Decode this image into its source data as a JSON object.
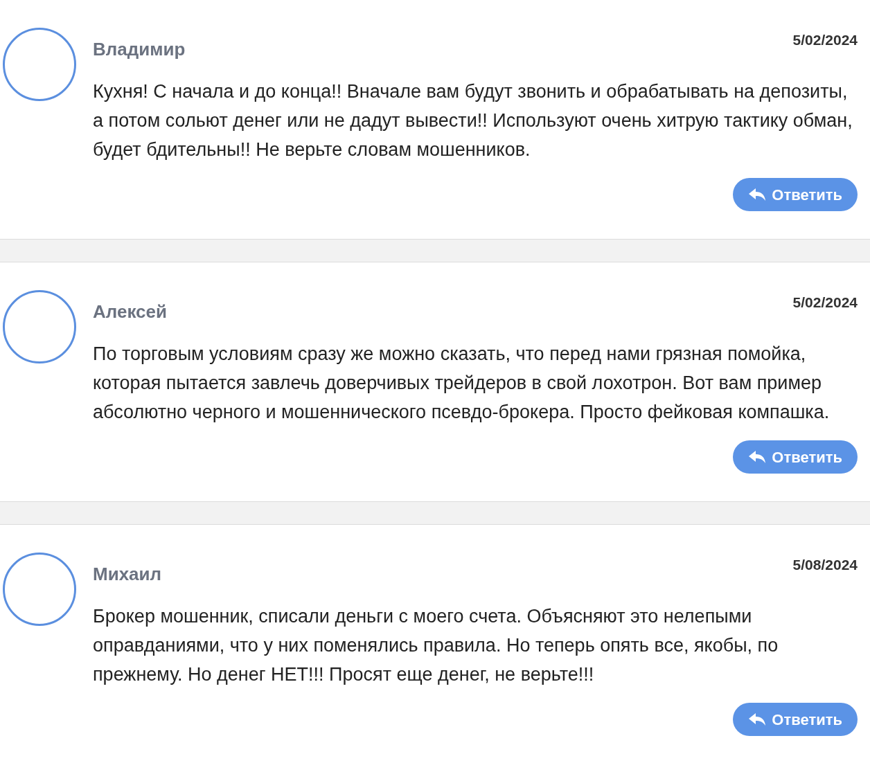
{
  "comments": [
    {
      "author": "Владимир",
      "date": "5/02/2024",
      "text": "Кухня! С начала и до конца!! Вначале вам будут звонить и обрабатывать на депозиты, а потом сольют денег или не дадут вывести!! Используют очень хитрую тактику обман, будет бдительны!! Не верьте словам мошенников.",
      "reply": "Ответить"
    },
    {
      "author": "Алексей",
      "date": "5/02/2024",
      "text": "По торговым условиям сразу же можно сказать, что перед нами грязная помойка, которая пытается завлечь доверчивых трейдеров в свой лохотрон. Вот вам пример абсолютно черного и мошеннического псевдо-брокера. Просто фейковая компашка.",
      "reply": "Ответить"
    },
    {
      "author": "Михаил",
      "date": "5/08/2024",
      "text": "Брокер мошенник, списали деньги с моего счета. Объясняют это нелепыми оправданиями, что у них поменялись правила. Но теперь опять все, якобы, по прежнему. Но денег НЕТ!!! Просят еще денег, не верьте!!!",
      "reply": "Ответить"
    }
  ]
}
